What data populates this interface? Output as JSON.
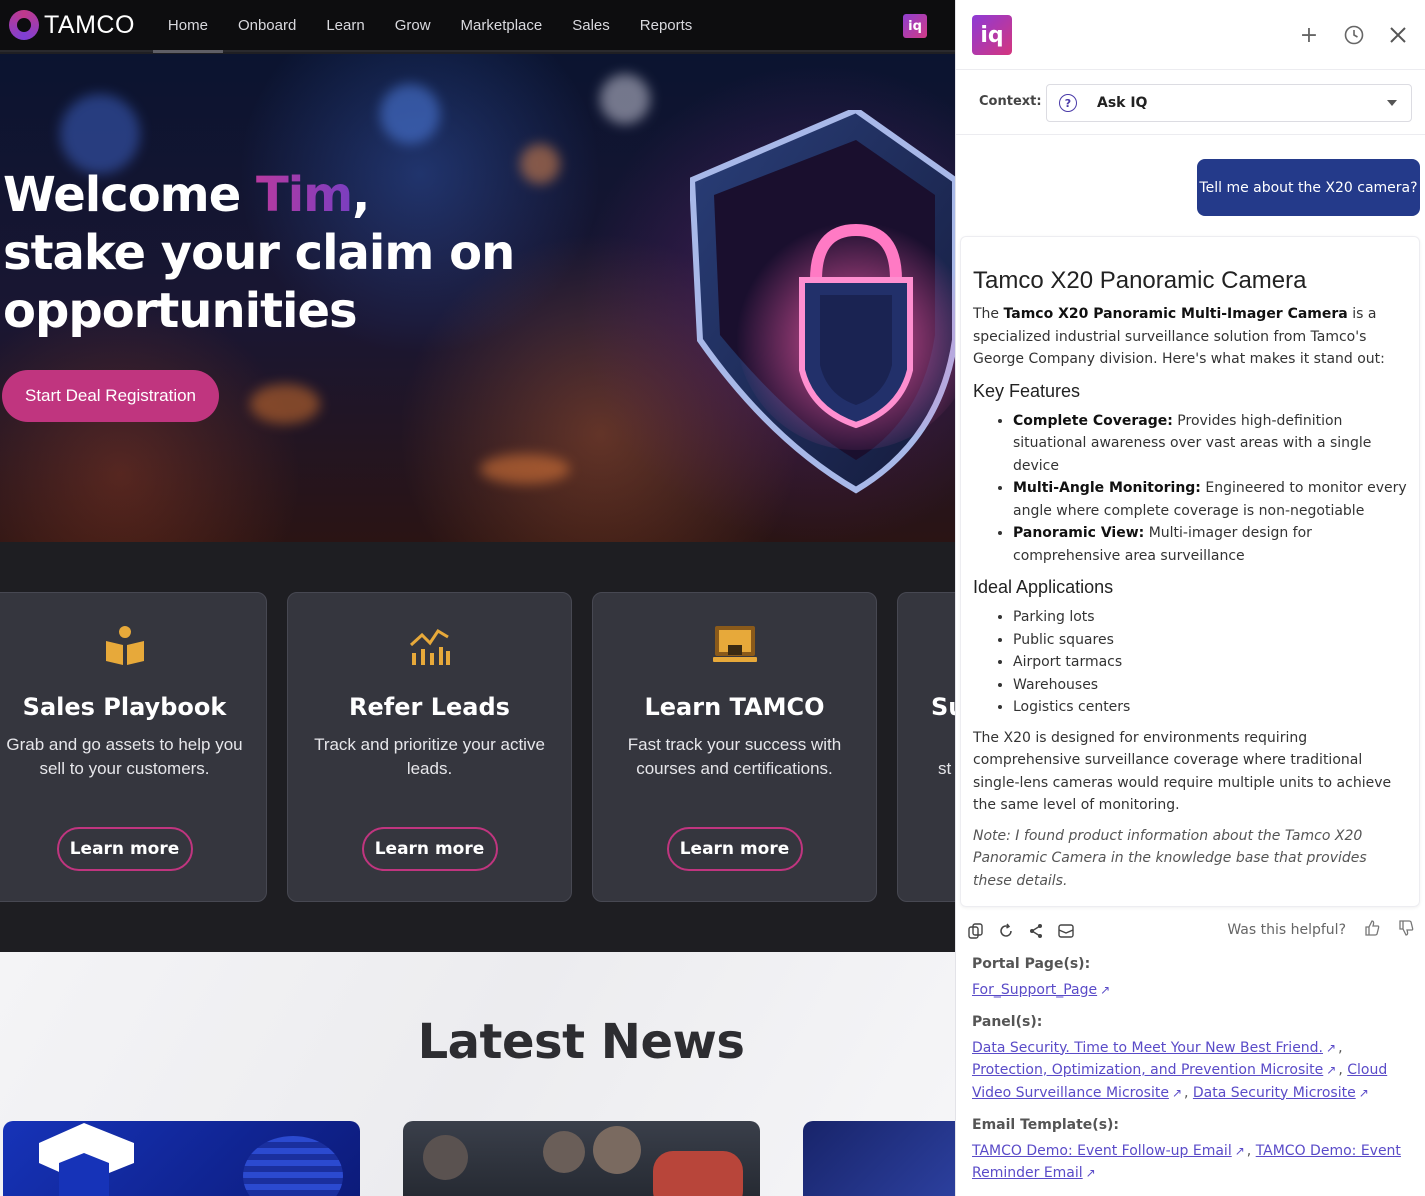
{
  "nav": {
    "brand": "TAMCO",
    "items": [
      {
        "label": "Home",
        "active": true
      },
      {
        "label": "Onboard"
      },
      {
        "label": "Learn"
      },
      {
        "label": "Grow"
      },
      {
        "label": "Marketplace"
      },
      {
        "label": "Sales"
      },
      {
        "label": "Reports"
      }
    ],
    "iq_badge": "iq"
  },
  "hero": {
    "title_prefix": "Welcome ",
    "name": "Tim",
    "title_suffix": ",",
    "line2": "stake your claim on",
    "line3": "opportunities",
    "cta": "Start Deal Registration"
  },
  "cards": [
    {
      "title": "Sales Playbook",
      "desc": "Grab and go assets to help you sell to your customers.",
      "button": "Learn more",
      "icon": "open-book-icon"
    },
    {
      "title": "Refer Leads",
      "desc": "Track and prioritize your active leads.",
      "button": "Learn more",
      "icon": "chart-growth-icon"
    },
    {
      "title": "Learn TAMCO",
      "desc": "Fast track your success with courses and certifications.",
      "button": "Learn more",
      "icon": "laptop-icon"
    },
    {
      "title": "Su",
      "desc": "st"
    }
  ],
  "news": {
    "title": "Latest News"
  },
  "panel": {
    "logo": "iq",
    "context_label": "Context:",
    "context_value": "Ask IQ",
    "user_message": "Tell me about the X20 camera?",
    "answer": {
      "title": "Tamco X20 Panoramic Camera",
      "intro_pre": "The ",
      "intro_bold": "Tamco X20 Panoramic Multi-Imager Camera",
      "intro_post": " is a specialized industrial surveillance solution from Tamco's George Company division. Here's what makes it stand out:",
      "features_heading": "Key Features",
      "features": [
        {
          "label": "Complete Coverage:",
          "text": " Provides high-definition situational awareness over vast areas with a single device"
        },
        {
          "label": "Multi-Angle Monitoring:",
          "text": " Engineered to monitor every angle where complete coverage is non-negotiable"
        },
        {
          "label": "Panoramic View:",
          "text": " Multi-imager design for comprehensive area surveillance"
        }
      ],
      "apps_heading": "Ideal Applications",
      "applications": [
        "Parking lots",
        "Public squares",
        "Airport tarmacs",
        "Warehouses",
        "Logistics centers"
      ],
      "summary": "The X20 is designed for environments requiring comprehensive surveillance coverage where traditional single-lens cameras would require multiple units to achieve the same level of monitoring.",
      "note": "Note: I found product information about the Tamco X20 Panoramic Camera in the knowledge base that provides these details."
    },
    "helpful_label": "Was this helpful?",
    "refs": {
      "portal_heading": "Portal Page(s):",
      "portal_links": [
        "For_Support_Page"
      ],
      "panel_heading": "Panel(s):",
      "panel_links": [
        "Data Security. Time to Meet Your New Best Friend.",
        "Protection, Optimization, and Prevention Microsite",
        "Cloud Video Surveillance Microsite",
        "Data Security Microsite"
      ],
      "email_heading": "Email Template(s):",
      "email_links": [
        "TAMCO Demo: Event Follow-up Email",
        "TAMCO Demo: Event Reminder Email"
      ]
    }
  }
}
